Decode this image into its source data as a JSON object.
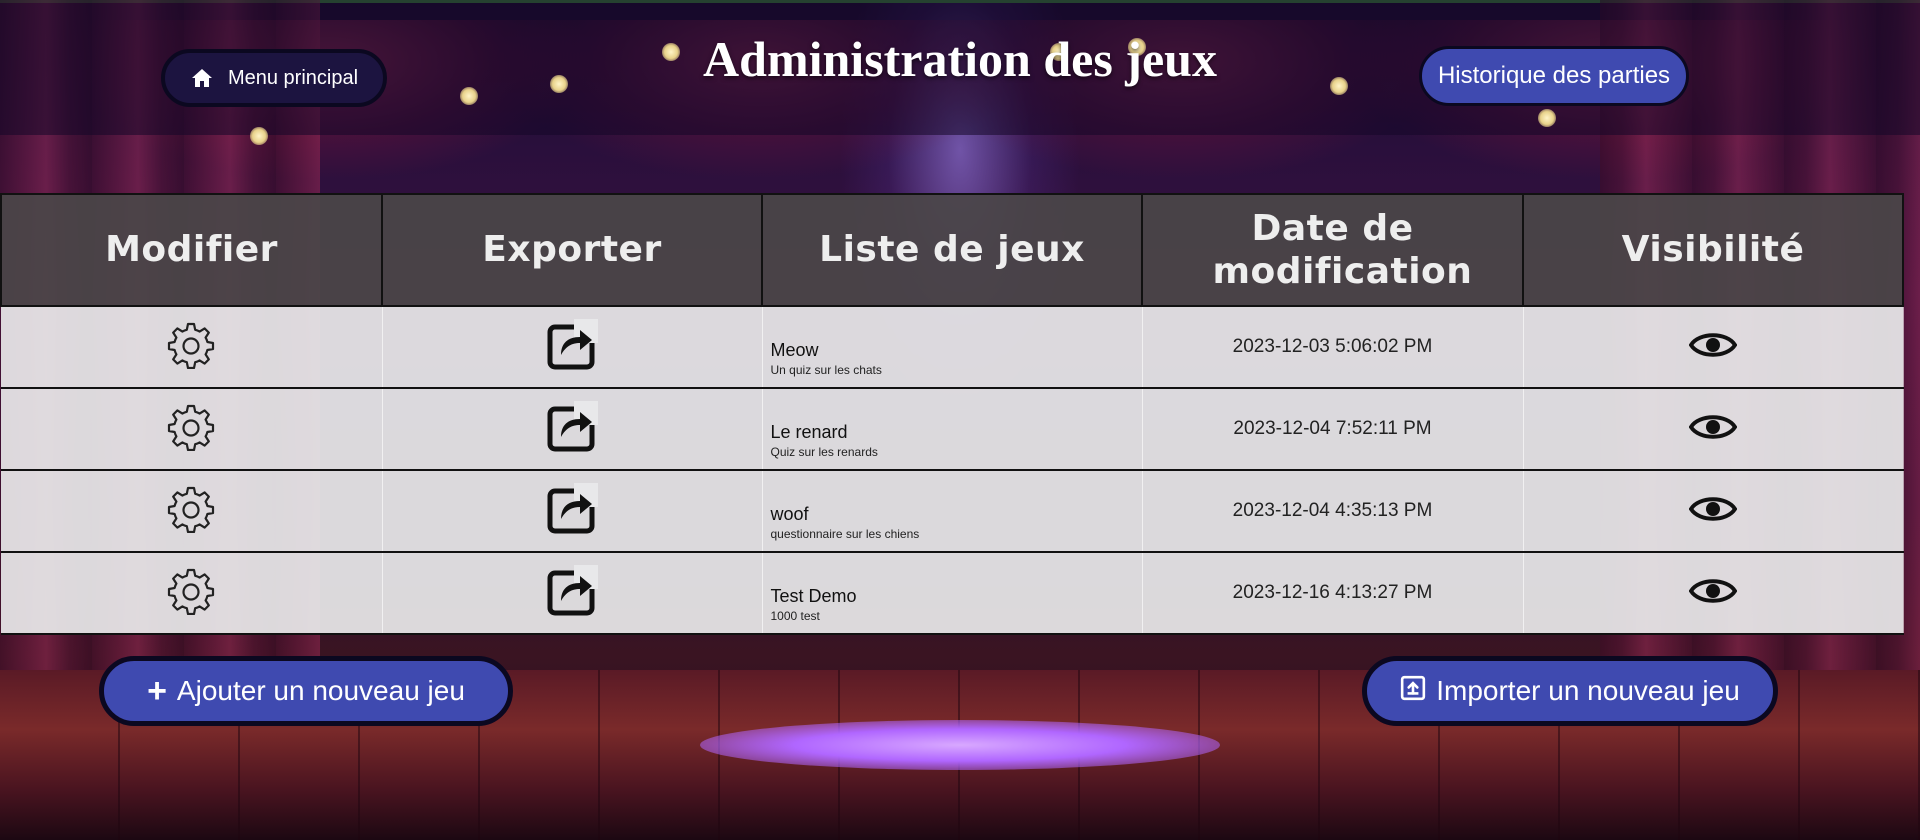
{
  "header": {
    "menu_label": "Menu principal",
    "title": "Administration des jeux",
    "history_label": "Historique des parties"
  },
  "table": {
    "columns": [
      "Modifier",
      "Exporter",
      "Liste de jeux",
      "Date de modification",
      "Visibilité"
    ],
    "rows": [
      {
        "title": "Meow",
        "description": "Un quiz sur les chats",
        "date": "2023-12-03 5:06:02 PM",
        "visible": true
      },
      {
        "title": "Le renard",
        "description": "Quiz sur les renards",
        "date": "2023-12-04 7:52:11 PM",
        "visible": true
      },
      {
        "title": "woof",
        "description": "questionnaire sur les chiens",
        "date": "2023-12-04 4:35:13 PM",
        "visible": true
      },
      {
        "title": "Test Demo",
        "description": "1000 test",
        "date": "2023-12-16 4:13:27 PM",
        "visible": true
      }
    ]
  },
  "actions": {
    "add_label": "Ajouter un nouveau jeu",
    "import_label": "Importer un nouveau jeu"
  },
  "icons": {
    "home": "home-icon",
    "edit": "gear-icon",
    "export": "export-icon",
    "visibility": "eye-icon",
    "add": "plus-icon",
    "import": "upload-icon"
  },
  "colors": {
    "accent_button": "#3f4ab0",
    "header_cell": "#4a4648",
    "row_bg": "#e8e8ea"
  }
}
